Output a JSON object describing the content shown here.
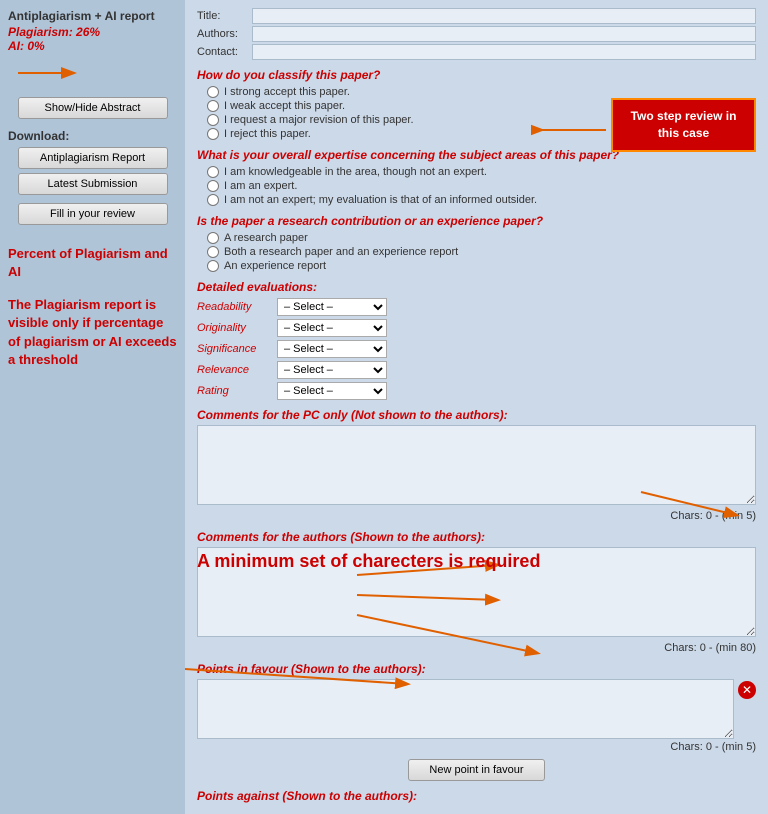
{
  "sidebar": {
    "title": "Antiplagiarism + AI report",
    "plagiarism_label": "Plagiarism:",
    "plagiarism_value": "26%",
    "ai_label": "AI:",
    "ai_value": "0%",
    "show_hide_btn": "Show/Hide Abstract",
    "download_label": "Download:",
    "antiplagiarism_btn": "Antiplagiarism Report",
    "latest_submission_btn": "Latest Submission",
    "fill_review_btn": "Fill in your review",
    "annotation1_title": "Percent of Plagiarism and AI",
    "annotation2_title": "The Plagiarism report is visible only if percentage of plagiarism or AI exceeds a threshold"
  },
  "meta": {
    "title_label": "Title:",
    "authors_label": "Authors:",
    "contact_label": "Contact:"
  },
  "form": {
    "q1_label": "How do you classify this paper?",
    "q1_options": [
      "I strong accept this paper.",
      "I weak accept this paper.",
      "I request a major revision of this paper.",
      "I reject this paper."
    ],
    "q2_label": "What is your overall expertise concerning the subject areas of this paper?",
    "q2_options": [
      "I am knowledgeable in the area, though not an expert.",
      "I am an expert.",
      "I am not an expert; my evaluation is that of an informed outsider."
    ],
    "q3_label": "Is the paper a research contribution or an experience paper?",
    "q3_options": [
      "A research paper",
      "Both a research paper and an experience report",
      "An experience report"
    ],
    "detailed_label": "Detailed evaluations:",
    "evals": [
      {
        "name": "Readability",
        "value": "– Select –"
      },
      {
        "name": "Originality",
        "value": "– Select –"
      },
      {
        "name": "Significance",
        "value": "– Select –"
      },
      {
        "name": "Relevance",
        "value": "– Select –"
      },
      {
        "name": "Rating",
        "value": "– Select –"
      }
    ],
    "pc_comments_label": "Comments for the PC only (Not shown to the authors):",
    "pc_chars": "Chars: 0 - (min 5)",
    "authors_comments_label": "Comments for the authors (Shown to the authors):",
    "authors_chars": "Chars: 0 - (min 80)",
    "points_favour_label": "Points in favour (Shown to the authors):",
    "favour_chars": "Chars: 0 - (min 5)",
    "new_point_favour_btn": "New point in favour",
    "points_against_label": "Points against (Shown to the authors):"
  },
  "annotations": {
    "two_step_review": "Two step review in this case",
    "min_chars_required": "A minimum set of charecters is required"
  }
}
